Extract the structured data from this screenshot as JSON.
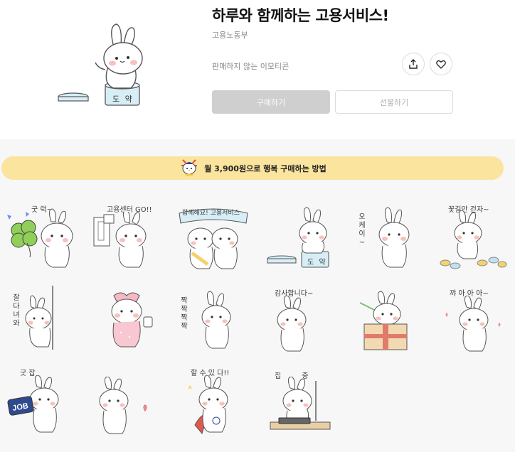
{
  "product": {
    "title": "하루와 함께하는 고용서비스!",
    "author": "고용노동부",
    "sale_status": "판매하지 않는 이모티콘",
    "buy_label": "구매하기",
    "gift_label": "선물하기",
    "hero_jar_label": "도 약"
  },
  "actions": {
    "share_icon": "share-icon",
    "like_icon": "heart-icon"
  },
  "banner": {
    "text": "월 3,900원으로 행복 구매하는 방법",
    "icon": "chick-mascot-icon"
  },
  "stickers": [
    {
      "caption": "굿 럭~",
      "prop": "clover"
    },
    {
      "caption": "고용센터 GO!!",
      "prop": "building"
    },
    {
      "caption": "함께해요! 고용서비스",
      "prop": "banner"
    },
    {
      "caption": "도 약",
      "prop": "jar"
    },
    {
      "caption": "오케이~",
      "prop": "none"
    },
    {
      "caption": "꽃길만 걷자~",
      "prop": "flowers"
    },
    {
      "caption": "잘다녀와",
      "prop": "wall"
    },
    {
      "caption": "",
      "prop": "ribbon"
    },
    {
      "caption": "짝짝짝짝",
      "prop": "clap"
    },
    {
      "caption": "감사합니다~",
      "prop": "bow"
    },
    {
      "caption": "",
      "prop": "box"
    },
    {
      "caption": "꺄 아 아 아~",
      "prop": "hearts"
    },
    {
      "caption": "굿 잡",
      "prop": "job"
    },
    {
      "caption": "",
      "prop": "heart"
    },
    {
      "caption": "할 수 있 다!!",
      "prop": "cape"
    },
    {
      "caption": "집 중",
      "prop": "keyboard"
    }
  ],
  "job_sign": "JOB",
  "colors": {
    "banner_bg": "#fae49e",
    "buy_disabled": "#cfcfcf",
    "content_bg": "#f7f7f7"
  }
}
